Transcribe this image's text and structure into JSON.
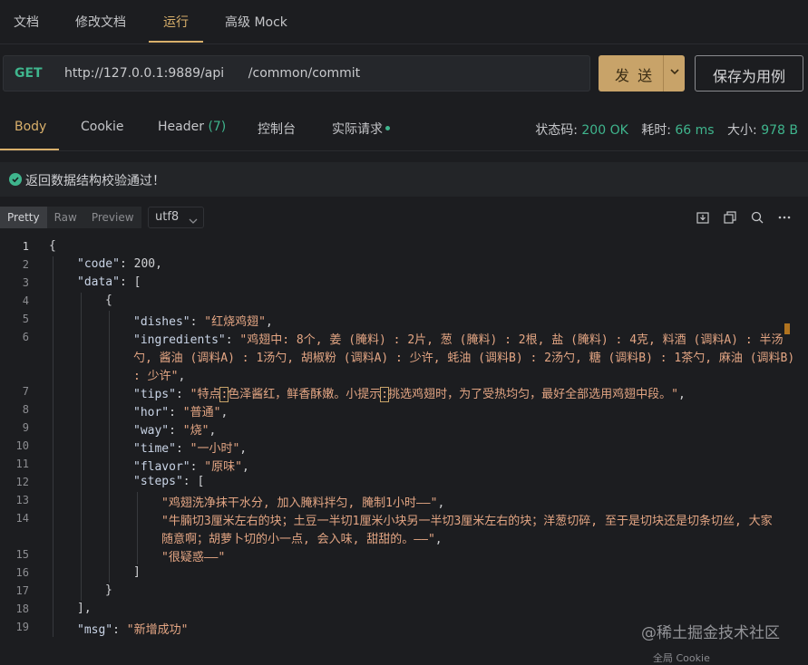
{
  "top_tabs": [
    "文档",
    "修改文档",
    "运行",
    "高级 Mock"
  ],
  "request": {
    "method": "GET",
    "url": "http://127.0.0.1:9889/api      /common/commit",
    "send_label": "发 送",
    "save_label": "保存为用例"
  },
  "response_tabs": {
    "body": "Body",
    "cookie": "Cookie",
    "header": "Header",
    "header_count": "(7)",
    "console": "控制台",
    "actual": "实际请求"
  },
  "stats": {
    "status_label": "状态码:",
    "status_value": "200 OK",
    "time_label": "耗时:",
    "time_value": "66 ms",
    "size_label": "大小:",
    "size_value": "978 B"
  },
  "notice": "返回数据结构校验通过！",
  "formats": [
    "Pretty",
    "Raw",
    "Preview"
  ],
  "encoding": "utf8",
  "line_numbers": [
    "1",
    "2",
    "3",
    "4",
    "5",
    "6",
    "7",
    "8",
    "9",
    "10",
    "11",
    "12",
    "13",
    "14",
    "15",
    "16",
    "17",
    "18",
    "19"
  ],
  "json": {
    "l1": "{",
    "code_key": "\"code\"",
    "code_val": "200",
    "data_key": "\"data\"",
    "bracket_open": "[",
    "brace_open": "{",
    "dishes_key": "\"dishes\"",
    "dishes_val": "\"红烧鸡翅\"",
    "ingredients_key": "\"ingredients\"",
    "ingredients_l1": "\"鸡翅中: 8个, 姜 (腌料) : 2片, 葱 (腌料) : 2根, 盐 (腌料) : 4克, 料酒 (调料A) : 半汤",
    "ingredients_l2": "勺, 酱油 (调料A) : 1汤勺, 胡椒粉 (调料A) : 少许, 蚝油 (调料B) : 2汤勺, 糖 (调料B) : 1茶勺, 麻油 (调料B)",
    "ingredients_l3": ": 少许\"",
    "tips_key": "\"tips\"",
    "tips_a": "\"特点",
    "tips_b": ":",
    "tips_c": "色泽酱红，鲜香酥嫩。小提示",
    "tips_d": ":",
    "tips_e": "挑选鸡翅时，为了受热均匀，最好全部选用鸡翅中段。\"",
    "hor_key": "\"hor\"",
    "hor_val": "\"普通\"",
    "way_key": "\"way\"",
    "way_val": "\"烧\"",
    "time_key": "\"time\"",
    "time_val": "\"一小时\"",
    "flavor_key": "\"flavor\"",
    "flavor_val": "\"原味\"",
    "steps_key": "\"steps\"",
    "step1": "\"鸡翅洗净抹干水分, 加入腌料拌匀, 腌制1小时——\"",
    "step2_l1": "\"牛腩切3厘米左右的块；土豆一半切1厘米小块另一半切3厘米左右的块；洋葱切碎, 至于是切块还是切条切丝, 大家",
    "step2_l2": "随意啊；胡萝卜切的小一点, 会入味, 甜甜的。——\"",
    "step3": "\"很疑惑——\"",
    "bracket_close": "]",
    "brace_close": "}",
    "data_close": "],",
    "msg_key": "\"msg\"",
    "msg_val": "\"新增成功\""
  },
  "watermark": "@稀土掘金技术社区",
  "bottom_text": "全局 Cookie"
}
